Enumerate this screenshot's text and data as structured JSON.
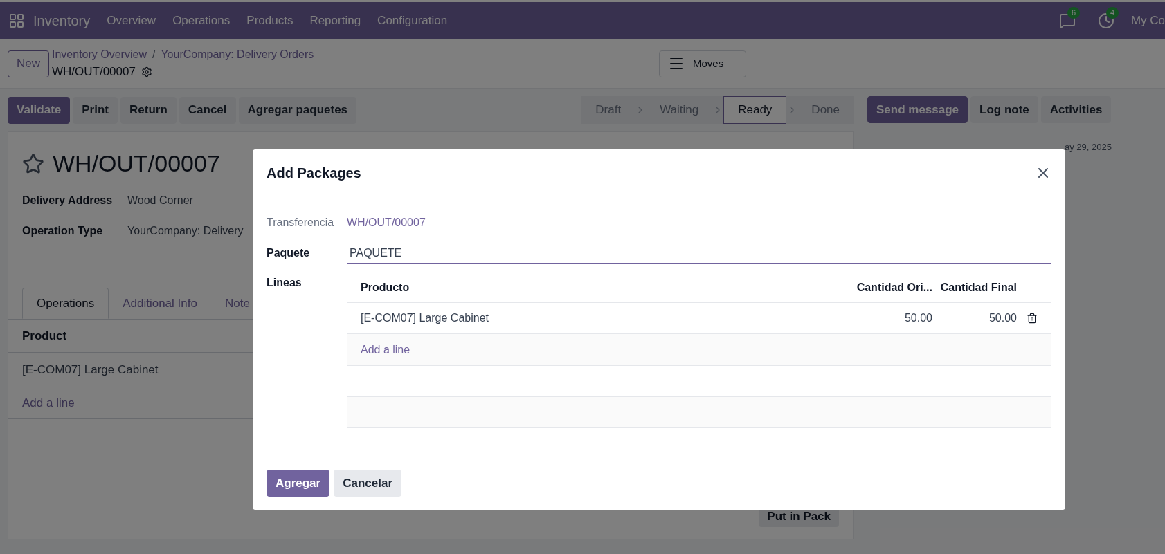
{
  "navbar": {
    "app_name": "Inventory",
    "menu": [
      "Overview",
      "Operations",
      "Products",
      "Reporting",
      "Configuration"
    ],
    "messages_badge": "6",
    "activities_badge": "4",
    "company": "My Co"
  },
  "control_panel": {
    "new_button": "New",
    "breadcrumbs": [
      "Inventory Overview",
      "YourCompany: Delivery Orders"
    ],
    "breadcrumb_separator": "/",
    "record": "WH/OUT/00007",
    "moves_button": "Moves"
  },
  "actions": [
    {
      "label": "Validate",
      "kind": "primary"
    },
    {
      "label": "Print",
      "kind": "secondary"
    },
    {
      "label": "Return",
      "kind": "secondary"
    },
    {
      "label": "Cancel",
      "kind": "secondary"
    },
    {
      "label": "Agregar paquetes",
      "kind": "secondary"
    }
  ],
  "stages": [
    {
      "label": "Draft",
      "selected": false
    },
    {
      "label": "Waiting",
      "selected": false
    },
    {
      "label": "Ready",
      "selected": true
    },
    {
      "label": "Done",
      "selected": false
    }
  ],
  "chatter": {
    "buttons": [
      {
        "label": "Send message",
        "kind": "primary"
      },
      {
        "label": "Log note",
        "kind": "secondary"
      },
      {
        "label": "Activities",
        "kind": "secondary"
      }
    ],
    "date": "ay 29, 2025"
  },
  "form": {
    "title": "WH/OUT/00007",
    "starred": false,
    "fields": [
      {
        "label": "Delivery Address",
        "value": "Wood Corner"
      },
      {
        "label": "Operation Type",
        "value": "YourCompany: Delivery"
      }
    ],
    "tabs": [
      {
        "label": "Operations",
        "selected": true
      },
      {
        "label": "Additional Info",
        "selected": false
      },
      {
        "label": "Note",
        "selected": false
      }
    ],
    "list": {
      "column": "Product",
      "rows": [
        "[E-COM07] Large Cabinet"
      ],
      "add_line": "Add a line"
    },
    "put_in_pack": "Put in Pack"
  },
  "modal": {
    "title": "Add Packages",
    "transfer_label": "Transferencia",
    "transfer_value": "WH/OUT/00007",
    "package_label": "Paquete",
    "package_value": "PAQUETE",
    "lines_label": "Lineas",
    "columns": [
      "Producto",
      "Cantidad Ori...",
      "Cantidad Final"
    ],
    "rows": [
      {
        "product": "[E-COM07] Large Cabinet",
        "original": "50.00",
        "final": "50.00"
      }
    ],
    "add_line": "Add a line",
    "buttons": [
      {
        "label": "Agregar",
        "kind": "primary"
      },
      {
        "label": "Cancelar",
        "kind": "secondary"
      }
    ]
  }
}
